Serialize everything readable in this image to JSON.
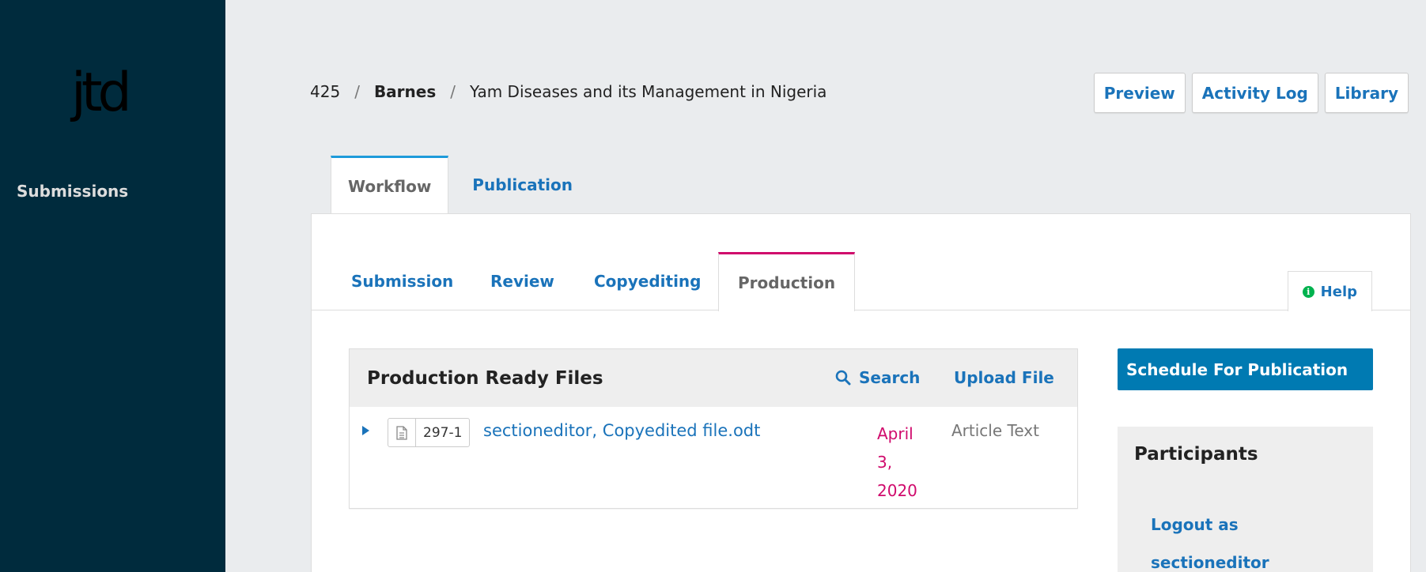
{
  "sidebar": {
    "logo_text": "jtd",
    "nav_submissions": "Submissions"
  },
  "breadcrumb": {
    "id": "425",
    "separator": "/",
    "author": "Barnes",
    "title": "Yam Diseases and its Management in Nigeria"
  },
  "header_actions": {
    "preview": "Preview",
    "activity_log": "Activity Log",
    "library": "Library"
  },
  "top_tabs": {
    "workflow": "Workflow",
    "publication": "Publication"
  },
  "stage_tabs": {
    "submission": "Submission",
    "review": "Review",
    "copyediting": "Copyediting",
    "production": "Production",
    "help": "Help"
  },
  "grid": {
    "title": "Production Ready Files",
    "search_label": "Search",
    "upload_label": "Upload File",
    "rows": [
      {
        "id": "297-1",
        "name": "sectioneditor, Copyedited file.odt",
        "date": "April 3, 2020",
        "type": "Article Text"
      }
    ]
  },
  "actions": {
    "schedule": "Schedule For Publication"
  },
  "participants": {
    "title": "Participants",
    "logout_as": "Logout as sectioneditor"
  },
  "colors": {
    "sidebar_bg": "#002b3d",
    "link": "#1a73ba",
    "primary_button": "#007ab2",
    "workflow_tab_accent": "#1e9bda",
    "stage_tab_accent": "#d00a6c",
    "date_text": "#d00a6c",
    "help_icon": "#00b24e"
  }
}
